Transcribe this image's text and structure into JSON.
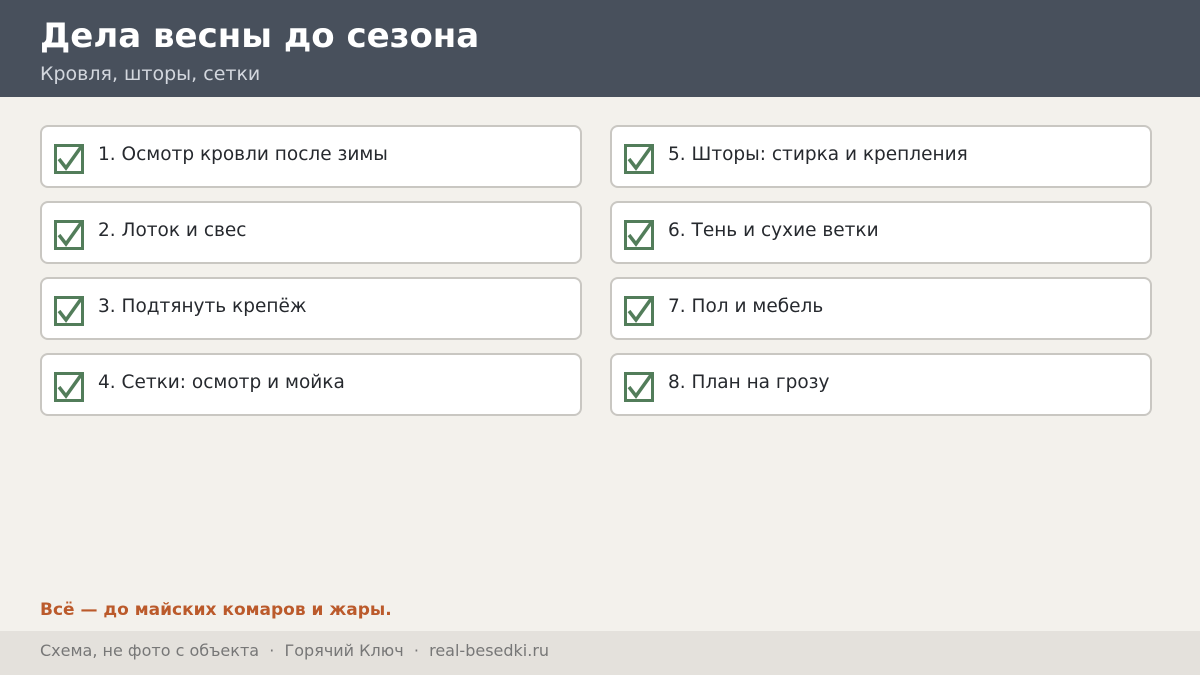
{
  "header": {
    "title": "Дела весны до сезона",
    "subtitle": "Кровля, шторы, сетки"
  },
  "checklist": [
    {
      "label": "1. Осмотр кровли после зимы",
      "checked": true
    },
    {
      "label": "2. Лоток и свес",
      "checked": true
    },
    {
      "label": "3. Подтянуть крепёж",
      "checked": true
    },
    {
      "label": "4. Сетки: осмотр и мойка",
      "checked": true
    },
    {
      "label": "5. Шторы: стирка и крепления",
      "checked": true
    },
    {
      "label": "6. Тень и сухие ветки",
      "checked": true
    },
    {
      "label": "7. Пол и мебель",
      "checked": true
    },
    {
      "label": "8. План на грозу",
      "checked": true
    }
  ],
  "note": "Всё — до майских комаров и жары.",
  "footer": {
    "text": "Схема, не фото с объекта  ·  Горячий Ключ  ·  real-besedki.ru"
  },
  "colors": {
    "header_bg": "#48505c",
    "check_green": "#527d5a",
    "note_accent": "#bb5a2b"
  }
}
